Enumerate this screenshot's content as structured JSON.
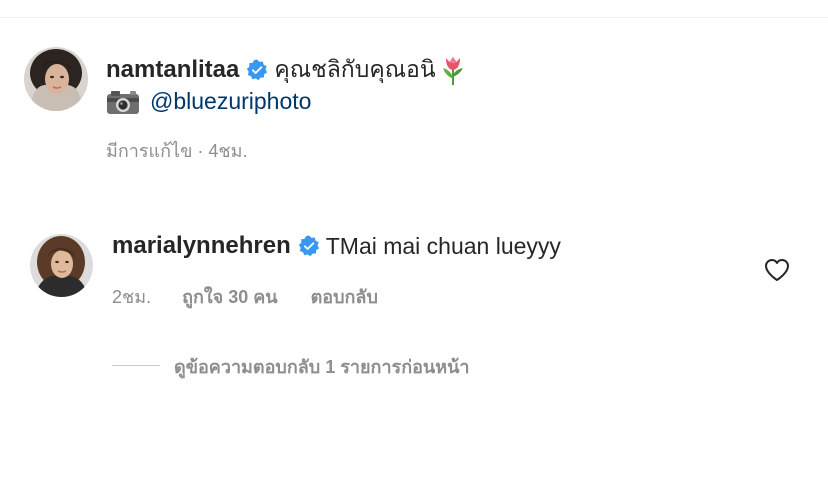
{
  "comments": [
    {
      "username": "namtanlitaa",
      "text": "คุณชลิกับคุณอนิ",
      "emoji": "tulip-emoji",
      "mention": "@bluezuriphoto",
      "camera_emoji": "camera-emoji",
      "meta": "มีการแก้ไข · 4ชม."
    },
    {
      "username": "marialynnehren",
      "text": "TMai mai chuan lueyyy",
      "time": "2ชม.",
      "likes": "ถูกใจ 30 คน",
      "reply_label": "ตอบกลับ"
    }
  ],
  "view_replies_label": "ดูข้อความตอบกลับ 1 รายการก่อนหน้า",
  "colors": {
    "text": "#262626",
    "secondary": "#8e8e8e",
    "link": "#00376b",
    "verified": "#3897f0"
  }
}
